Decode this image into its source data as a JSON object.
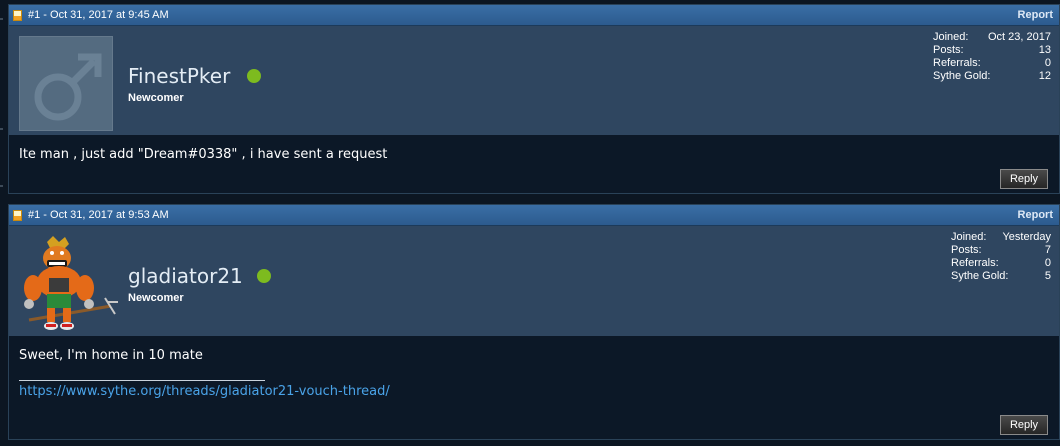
{
  "posts": [
    {
      "meta": "#1 - Oct 31, 2017 at 9:45 AM",
      "report_label": "Report",
      "username": "FinestPker",
      "usertitle": "Newcomer",
      "online": true,
      "avatar": "default-male-avatar",
      "stats": {
        "joined_label": "Joined:",
        "joined_value": "Oct 23, 2017",
        "posts_label": "Posts:",
        "posts_value": "13",
        "referrals_label": "Referrals:",
        "referrals_value": "0",
        "gold_label": "Sythe Gold:",
        "gold_value": "12"
      },
      "message": "Ite man , just add \"Dream#0338\" , i have sent a request",
      "reply_label": "Reply"
    },
    {
      "meta": "#1 - Oct 31, 2017 at 9:53 AM",
      "report_label": "Report",
      "username": "gladiator21",
      "usertitle": "Newcomer",
      "online": true,
      "avatar": "gladiator-character-avatar",
      "stats": {
        "joined_label": "Joined:",
        "joined_value": "Yesterday",
        "posts_label": "Posts:",
        "posts_value": "7",
        "referrals_label": "Referrals:",
        "referrals_value": "0",
        "gold_label": "Sythe Gold:",
        "gold_value": "5"
      },
      "message": "Sweet, I'm home in 10 mate",
      "signature_link": "https://www.sythe.org/threads/gladiator21-vouch-thread/",
      "reply_label": "Reply"
    }
  ],
  "colors": {
    "header_blue": "#2c5b8e",
    "userbar": "#2f4660",
    "body_bg": "#0c1827",
    "online_green": "#7dbb1f",
    "link_blue": "#4aa3e8"
  }
}
